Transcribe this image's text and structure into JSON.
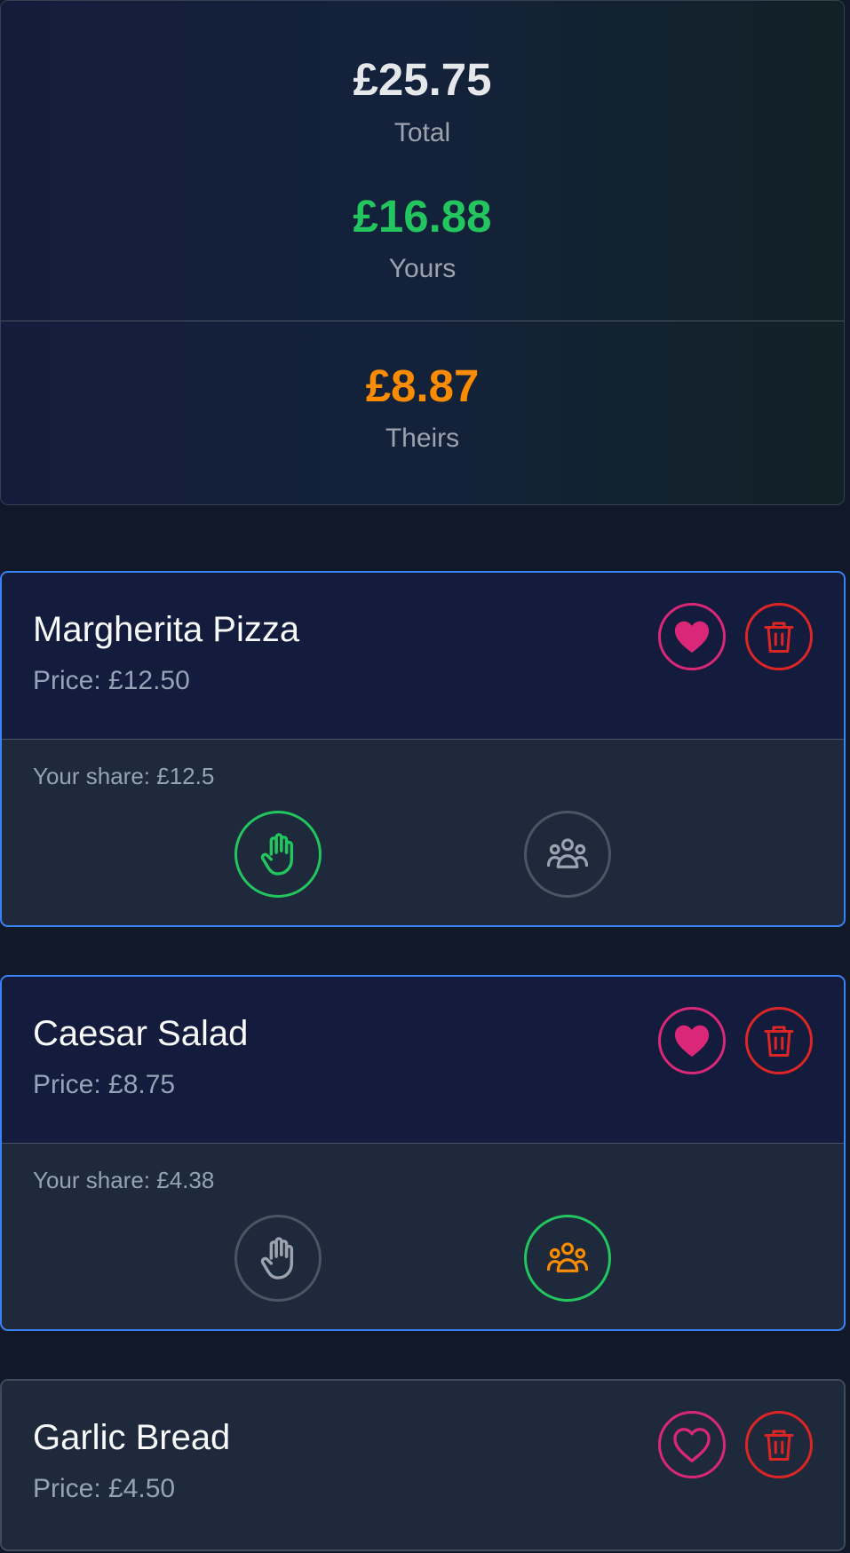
{
  "summary": {
    "total_amount": "£25.75",
    "total_label": "Total",
    "yours_amount": "£16.88",
    "yours_label": "Yours",
    "theirs_amount": "£8.87",
    "theirs_label": "Theirs"
  },
  "items": [
    {
      "name": "Margherita Pizza",
      "price": "Price: £12.50",
      "share": "Your share: £12.5",
      "favorite": true,
      "selected_mode": "mine"
    },
    {
      "name": "Caesar Salad",
      "price": "Price: £8.75",
      "share": "Your share: £4.38",
      "favorite": true,
      "selected_mode": "shared"
    },
    {
      "name": "Garlic Bread",
      "price": "Price: £4.50",
      "favorite": false
    }
  ],
  "colors": {
    "background": "#111827",
    "yours": "#22c55e",
    "theirs": "#fb8c00",
    "favorite": "#db2777",
    "delete": "#dc2626",
    "selected_border": "#3b82f6",
    "muted_icon": "#9ca3af"
  },
  "icons": {
    "favorite_filled": "heart-filled-icon",
    "favorite_outline": "heart-outline-icon",
    "delete": "trash-icon",
    "mine": "hand-icon",
    "shared": "group-icon"
  }
}
